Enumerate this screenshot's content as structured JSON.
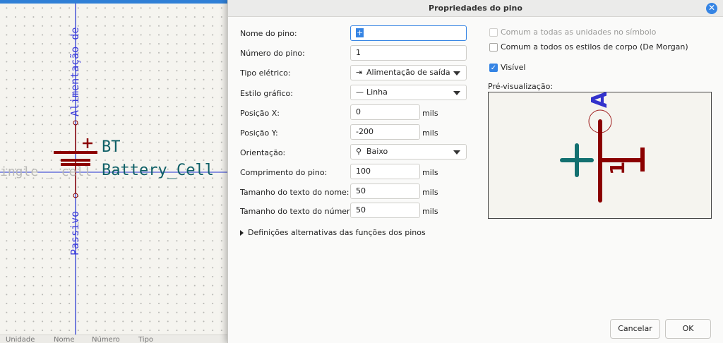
{
  "canvas": {
    "pin_top_name": "Alimentação de",
    "pin_bottom_name": "Passivo",
    "ref": "BT",
    "value": "Battery_Cell",
    "ghost_text": "ingle _ cell",
    "colors": {
      "wire": "#1e2fd0",
      "body": "#8b0000",
      "text": "#0e5f66",
      "pin_name": "#3b3bdb"
    }
  },
  "statusbar": {
    "labels": [
      "Unidade",
      "Nome",
      "Número",
      "Tipo"
    ]
  },
  "dialog": {
    "title": "Propriedades do pino",
    "fields": {
      "pin_name": {
        "label": "Nome do pino:",
        "value": "+"
      },
      "pin_number": {
        "label": "Número do pino:",
        "value": "1"
      },
      "electrical_type": {
        "label": "Tipo elétrico:",
        "value": "Alimentação de saída",
        "icon": "power-output-icon"
      },
      "graphic_style": {
        "label": "Estilo gráfico:",
        "value": "Linha",
        "icon": "line-icon"
      },
      "pos_x": {
        "label": "Posição X:",
        "value": "0",
        "unit": "mils"
      },
      "pos_y": {
        "label": "Posição Y:",
        "value": "-200",
        "unit": "mils"
      },
      "orientation": {
        "label": "Orientação:",
        "value": "Baixo",
        "icon": "pin-down-icon"
      },
      "pin_length": {
        "label": "Comprimento do pino:",
        "value": "100",
        "unit": "mils"
      },
      "name_text_size": {
        "label": "Tamanho do texto do nome:",
        "value": "50",
        "unit": "mils"
      },
      "number_text_size": {
        "label": "Tamanho do texto do número:",
        "value": "50",
        "unit": "mils"
      }
    },
    "checkboxes": {
      "common_units": {
        "label": "Comum a todas as unidades no símbolo",
        "checked": false,
        "disabled": true
      },
      "common_styles": {
        "label": "Comum a todos os estilos de corpo (De Morgan)",
        "checked": false,
        "disabled": false
      },
      "visible": {
        "label": "Visível",
        "checked": true,
        "disabled": false
      }
    },
    "preview_label": "Pré-visualização:",
    "preview": {
      "pin_name": "A",
      "plus": "+",
      "number": "1"
    },
    "alt_defs": "Definições alternativas das funções dos pinos",
    "buttons": {
      "cancel": "Cancelar",
      "ok": "OK"
    }
  }
}
